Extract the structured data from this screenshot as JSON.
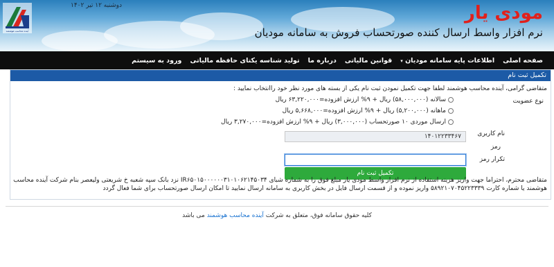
{
  "header": {
    "date": "دوشنبه ۱۲ تیر ۱۴۰۲",
    "brand": "مودی یار",
    "tagline": "نرم افزار واسط ارسال کننده صورتحساب فروش به سامانه موديان",
    "logo_caption": "آینده محاسب هوشمند"
  },
  "nav": {
    "items": [
      "صفحه اصلی",
      "اطلاعات پایه سامانه مودیان",
      "قوانین مالیاتی",
      "درباره ما",
      "تولید شناسه یکتای حافظه مالیاتی",
      "ورود به سیستم"
    ],
    "caret": "▾"
  },
  "panel": {
    "title": "تکمیل ثبت نام",
    "intro": "متقاضی گرامی، آینده محاسب هوشمند لطفا جهت تکمیل نمودن ثبت نام یکی از بسته های مورد نظر خود راانتخاب نمایید :",
    "membership_label": "نوع عضویت",
    "options": [
      "سالانه (۵۸,۰۰۰,۰۰۰) ریال + ۹% ارزش افزوده=۶۳,۲۲۰,۰۰۰ ریال",
      "ماهانه (۵,۲۰۰,۰۰۰) ریال + ۹% ارزش افزوده=۵,۶۶۸,۰۰۰ ریال",
      "ارسال موردی ۱۰ صورتحساب (۳,۰۰۰,۰۰۰) ریال + ۹% ارزش افزوده=۳,۲۷۰,۰۰۰ ریال"
    ],
    "username_label": "نام کاربری",
    "username_value": "۱۴۰۱۲۲۳۳۴۶۷",
    "password_label": "رمز",
    "password_value": "",
    "repeat_label": "تکرار رمز",
    "repeat_value": "",
    "submit_label": "تکمیل ثبت نام"
  },
  "notice": "متقاضی محترم، احتراما جهت واریز هزینه استفاده از نرم افزار واسط مودی یار مبلغ فوق را به شماره شبای IR۶۵۰۱۵۰۰۰۰۰۰۳۱۰۱۰۶۲۱۴۵۰۳۴ نزد بانک سپه شعبه خ شریعتی ولیعصر بنام شرکت آینده محاسب هوشمند یا شماره کارت ۵۸۹۲۱۰۷۰۴۵۲۲۳۳۳۹ واریز نموده و از قسمت ارسال فایل در بخش کاربری به سامانه ارسال نمایید تا امکان ارسال صورتحساب برای شما فعال گردد",
  "footer": {
    "prefix": "کلیه حقوق سامانه فوق، متعلق به شرکت",
    "company": "آینده محاسب هوشمند",
    "suffix": "می باشد"
  },
  "colors": {
    "brand": "#e0201c",
    "navbar": "#0e0e0e",
    "panel_head": "#1c5aa6",
    "submit": "#2eaa3c",
    "link": "#1a73d1"
  }
}
